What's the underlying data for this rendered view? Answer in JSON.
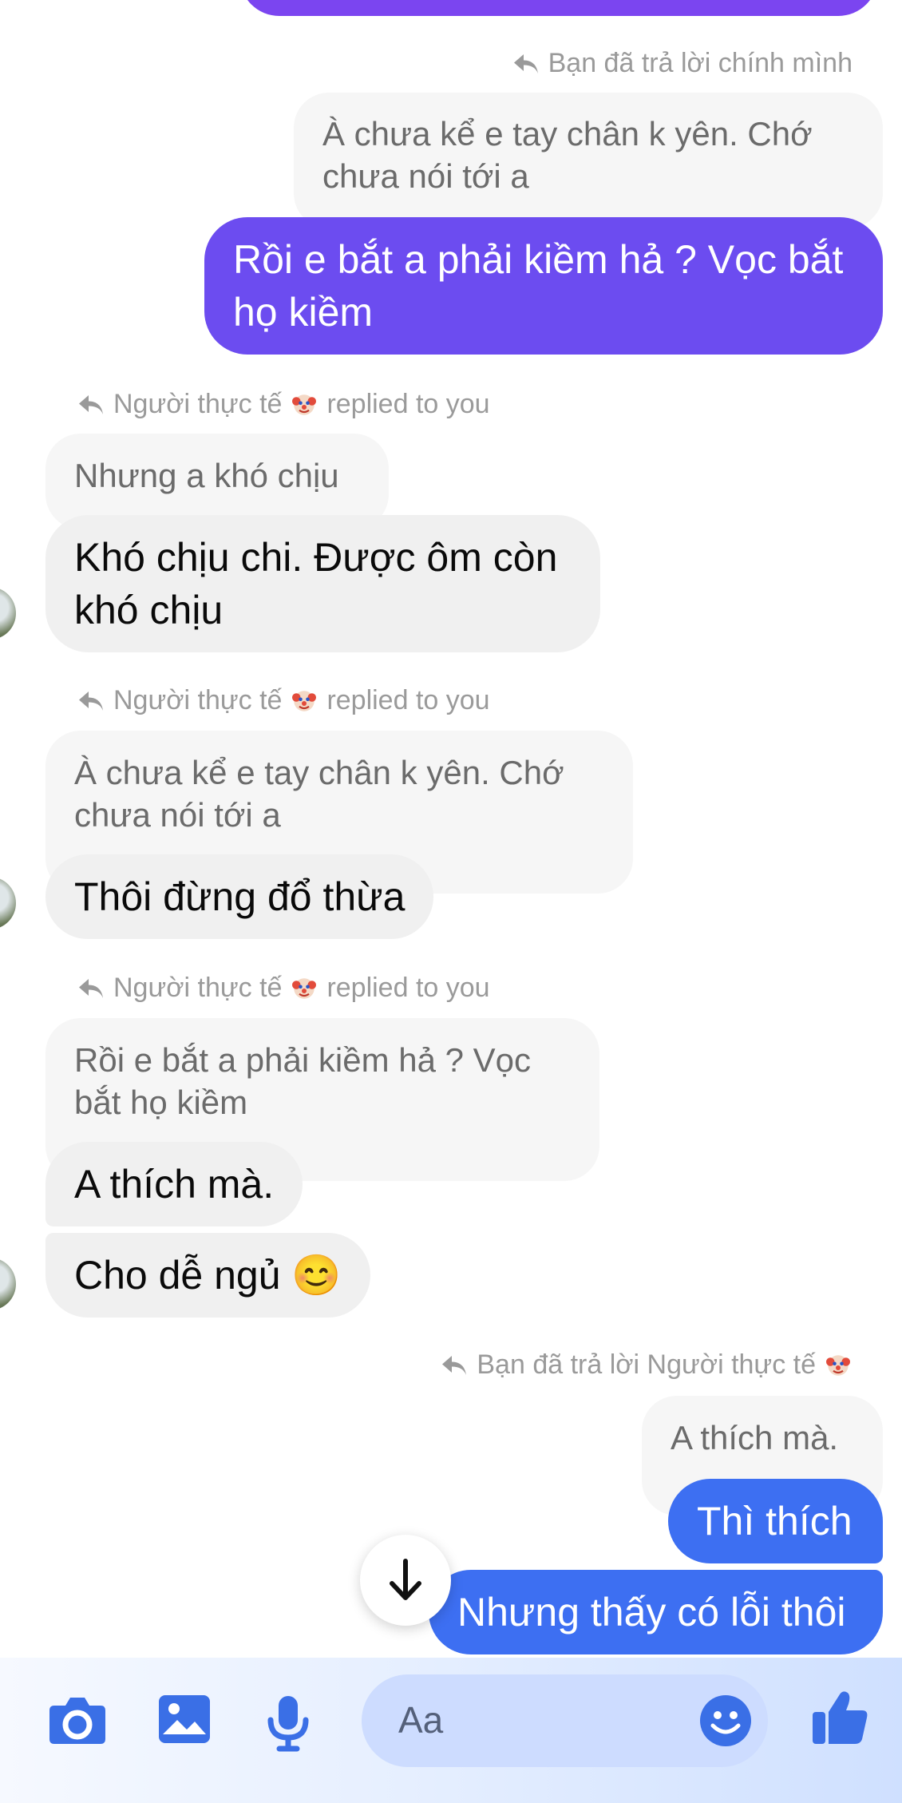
{
  "messages": {
    "reply_self_label": "Bạn đã trả lời chính mình",
    "quote1": "À chưa kể e tay chân k yên. Chớ chưa nói tới a",
    "out1": "Rồi e bắt a phải kiềm hả ? Vọc bắt họ kiềm",
    "reply_sender": "Người thực tế",
    "replied_to_you": "replied to you",
    "quote2": "Nhưng a khó chịu",
    "in1": "Khó chịu chi. Được ôm còn khó chịu",
    "quote3": "À chưa kể e tay chân k yên. Chớ chưa nói tới a",
    "in2": "Thôi đừng đổ thừa",
    "quote4": "Rồi e bắt a phải kiềm hả ? Vọc bắt họ kiềm",
    "in3": "A thích mà.",
    "in4": "Cho dễ ngủ 😊",
    "reply_you_to_label": "Bạn đã trả lời Người thực tế",
    "quote5": "A thích mà.",
    "out2": "Thì thích",
    "out3": "Nhưng thấy có lỗi thôi"
  },
  "composer": {
    "placeholder": "Aa"
  },
  "icons": {
    "camera": "camera-icon",
    "gallery": "image-icon",
    "mic": "microphone-icon",
    "emoji": "emoji-icon",
    "like": "thumbs-up-icon",
    "scroll_down": "arrow-down-icon",
    "reply": "reply-arrow-icon",
    "clown": "clown-face-emoji"
  },
  "colors": {
    "outgoing_purple": "#6c4cf0",
    "outgoing_blue": "#3d6ff2",
    "accent": "#3a6fe6"
  }
}
